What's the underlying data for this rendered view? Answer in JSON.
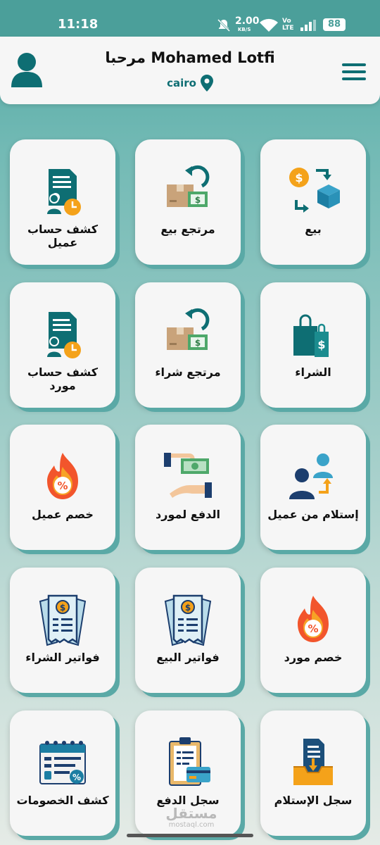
{
  "status_bar": {
    "time": "11:18",
    "speed": "2.00",
    "speed_unit": "KB/S",
    "network": "Vo LTE",
    "battery": "88"
  },
  "header": {
    "greeting": "مرحبا Mohamed Lotfi",
    "location": "cairo",
    "icons": {
      "avatar": "user-icon",
      "location": "location-pin-icon",
      "menu": "hamburger-menu-icon"
    }
  },
  "tiles": [
    {
      "label": "بيع",
      "icon": "sell-exchange-icon"
    },
    {
      "label": "مرتجع بيع",
      "icon": "sale-return-icon"
    },
    {
      "label": "كشف حساب عميل",
      "icon": "customer-statement-icon"
    },
    {
      "label": "الشراء",
      "icon": "purchase-bag-icon"
    },
    {
      "label": "مرتجع شراء",
      "icon": "purchase-return-icon"
    },
    {
      "label": "كشف حساب مورد",
      "icon": "supplier-statement-icon"
    },
    {
      "label": "إستلام من عميل",
      "icon": "receive-from-customer-icon"
    },
    {
      "label": "الدفع لمورد",
      "icon": "pay-supplier-icon"
    },
    {
      "label": "خصم عميل",
      "icon": "customer-discount-icon"
    },
    {
      "label": "خصم مورد",
      "icon": "supplier-discount-icon"
    },
    {
      "label": "فواتير البيع",
      "icon": "sales-invoices-icon"
    },
    {
      "label": "فواتير الشراء",
      "icon": "purchase-invoices-icon"
    },
    {
      "label": "سجل الإستلام",
      "icon": "receipts-log-icon"
    },
    {
      "label": "سجل الدفع",
      "icon": "payments-log-icon"
    },
    {
      "label": "كشف الخصومات",
      "icon": "discounts-statement-icon"
    }
  ],
  "watermark": {
    "arabic": "مستقل",
    "latin": "mostaql.com"
  },
  "colors": {
    "primary": "#0e6e73",
    "accent": "#f4a21a",
    "background": "#73bab5",
    "tile": "#f6f6f6"
  }
}
